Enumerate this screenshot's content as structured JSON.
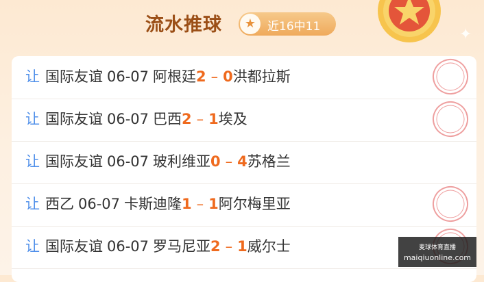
{
  "header": {
    "title": "流水推球",
    "badge_icon": "star-icon",
    "badge_text": "近16中11"
  },
  "matches": [
    {
      "tag": "让",
      "league": "国际友谊",
      "date": "06-07",
      "home": "阿根廷",
      "home_score": "2",
      "sep": "–",
      "away_score": "0",
      "away": "洪都拉斯",
      "stamp": "预测命中"
    },
    {
      "tag": "让",
      "league": "国际友谊",
      "date": "06-07",
      "home": "巴西",
      "home_score": "2",
      "sep": "–",
      "away_score": "1",
      "away": "埃及",
      "stamp": "预测命中"
    },
    {
      "tag": "让",
      "league": "国际友谊",
      "date": "06-07",
      "home": "玻利维亚",
      "home_score": "0",
      "sep": "–",
      "away_score": "4",
      "away": "苏格兰",
      "stamp": ""
    },
    {
      "tag": "让",
      "league": "西乙",
      "date": "06-07",
      "home": "卡斯迪隆",
      "home_score": "1",
      "sep": "–",
      "away_score": "1",
      "away": "阿尔梅里亚",
      "stamp": "预测命中"
    },
    {
      "tag": "让",
      "league": "国际友谊",
      "date": "06-07",
      "home": "罗马尼亚",
      "home_score": "2",
      "sep": "–",
      "away_score": "1",
      "away": "威尔士",
      "stamp": "预测命中"
    }
  ],
  "watermark": {
    "line1": "麦球体育直播",
    "line2": "maiqiuonline.com"
  },
  "colors": {
    "title": "#9b4f17",
    "tag": "#4f8fea",
    "score": "#ef6a1e",
    "stamp": "#e46060"
  }
}
